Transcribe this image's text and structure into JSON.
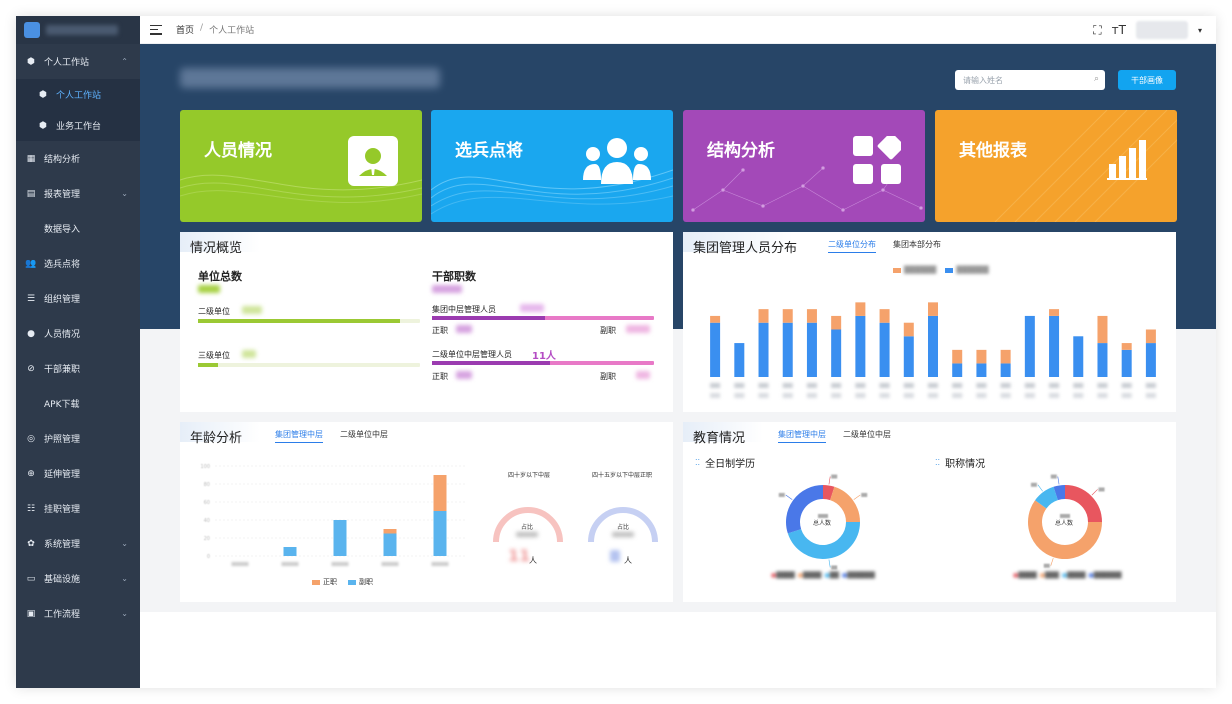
{
  "sidebar": {
    "items": [
      {
        "label": "个人工作站",
        "icon": "cube-icon",
        "expanded": true
      },
      {
        "label": "个人工作站",
        "icon": "cube-icon",
        "sub": true,
        "active": true
      },
      {
        "label": "业务工作台",
        "icon": "cube-icon",
        "sub": true
      },
      {
        "label": "结构分析",
        "icon": "grid-icon"
      },
      {
        "label": "报表管理",
        "icon": "table-icon",
        "arrow": true
      },
      {
        "label": "数据导入",
        "icon": ""
      },
      {
        "label": "选兵点将",
        "icon": "users-icon"
      },
      {
        "label": "组织管理",
        "icon": "list-icon"
      },
      {
        "label": "人员情况",
        "icon": "person-icon"
      },
      {
        "label": "干部兼职",
        "icon": "link-icon"
      },
      {
        "label": "APK下载",
        "icon": ""
      },
      {
        "label": "护照管理",
        "icon": "passport-icon"
      },
      {
        "label": "延伸管理",
        "icon": "plus-circle-icon"
      },
      {
        "label": "挂职管理",
        "icon": "list-tree-icon"
      },
      {
        "label": "系统管理",
        "icon": "gear-icon",
        "arrow": true
      },
      {
        "label": "基础设施",
        "icon": "monitor-icon",
        "arrow": true
      },
      {
        "label": "工作流程",
        "icon": "briefcase-icon",
        "arrow": true
      }
    ]
  },
  "topbar": {
    "breadcrumb": [
      "首页",
      "/",
      "个人工作站"
    ]
  },
  "banner": {
    "search_placeholder": "请输入姓名",
    "cadre_button": "干部画像"
  },
  "cards": [
    {
      "title": "人员情况",
      "color": "#95c92a",
      "icon": "person-badge-icon"
    },
    {
      "title": "选兵点将",
      "color": "#1aa7ef",
      "icon": "group-icon"
    },
    {
      "title": "结构分析",
      "color": "#a349b8",
      "icon": "shapes-icon"
    },
    {
      "title": "其他报表",
      "color": "#f5a22c",
      "icon": "bar-chart-icon"
    }
  ],
  "overview": {
    "title": "情况概览",
    "unit_total": "单位总数",
    "cadre_rank": "干部职数",
    "level2": "二级单位",
    "level3": "三级单位",
    "group_mid": "集团中层管理人员",
    "sub_mid": "二级单位中层管理人员",
    "sub_mid_value": "11人",
    "zheng": "正职",
    "fu": "副职",
    "level2_fill": 0.91,
    "level3_fill": 0.09,
    "group_mid_fill": 0.51,
    "sub_mid_fill": 0.53
  },
  "distribution": {
    "title": "集团管理人员分布",
    "tab_active": "二级单位分布",
    "tab_other": "集团本部分布"
  },
  "age": {
    "title": "年龄分析",
    "tab_active": "集团管理中层",
    "tab_other": "二级单位中层",
    "gauge1_label": "四十岁以下中层",
    "gauge2_label": "四十五岁以下中层正职",
    "gauge_inner": "占比",
    "gauge1_value": "11",
    "gauge_unit": "人",
    "legend_zheng": "正职",
    "legend_fu": "副职"
  },
  "edu": {
    "title": "教育情况",
    "tab_active": "集团管理中层",
    "tab_other": "二级单位中层",
    "sub1": "全日制学历",
    "sub2": "职称情况",
    "donut_center": "总人数"
  },
  "chart_data": [
    {
      "type": "bar",
      "name": "dist",
      "stacked": true,
      "series": [
        {
          "values": [
            1,
            0,
            2,
            2,
            2,
            2,
            2,
            2,
            2,
            2,
            2,
            2,
            2,
            0,
            1,
            0,
            4,
            1,
            2
          ]
        },
        {
          "values": [
            8,
            5,
            8,
            8,
            8,
            7,
            9,
            8,
            6,
            9,
            2,
            2,
            2,
            9,
            9,
            6,
            5,
            4,
            5
          ]
        }
      ],
      "colors": [
        "#f5a26b",
        "#3a8ff0"
      ],
      "ylim": [
        0,
        14
      ]
    },
    {
      "type": "bar",
      "name": "age",
      "stacked": true,
      "categories": [
        "",
        "",
        "",
        "",
        ""
      ],
      "series": [
        {
          "name": "正职",
          "values": [
            0,
            0,
            0,
            5,
            40
          ]
        },
        {
          "name": "副职",
          "values": [
            0,
            10,
            40,
            25,
            50
          ]
        }
      ],
      "colors": [
        "#f5a26b",
        "#5ab4ee"
      ],
      "ylim": [
        0,
        100
      ],
      "yticks": [
        0,
        20,
        40,
        60,
        80,
        100
      ]
    },
    {
      "type": "pie",
      "name": "edu-fulltime",
      "values": [
        5,
        20,
        45,
        30
      ],
      "colors": [
        "#e8565f",
        "#f5a26b",
        "#48b7f0",
        "#4a78e8"
      ]
    },
    {
      "type": "pie",
      "name": "edu-title",
      "values": [
        25,
        60,
        10,
        5
      ],
      "colors": [
        "#e8565f",
        "#f5a26b",
        "#48b7f0",
        "#4a78e8"
      ]
    }
  ]
}
